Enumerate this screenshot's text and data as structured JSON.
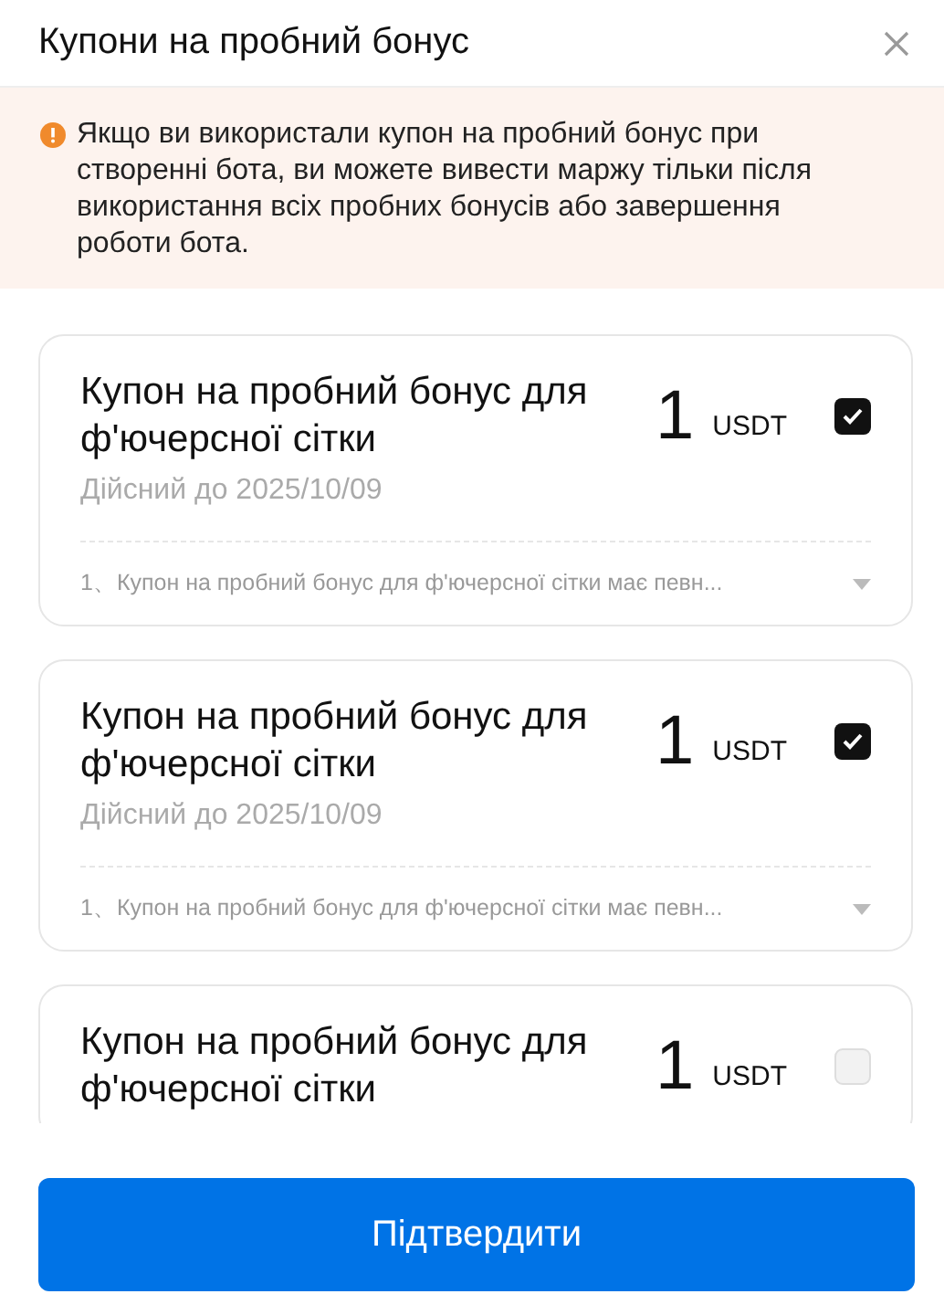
{
  "header": {
    "title": "Купони на пробний бонус"
  },
  "notice": {
    "text": "Якщо ви використали купон на пробний бонус при створенні бота, ви можете вивести маржу тільки після використання всіх пробних бонусів або завершення роботи бота."
  },
  "coupons": [
    {
      "title": "Купон на пробний бонус для ф'ючерсної сітки",
      "amount": "1",
      "currency": "USDT",
      "checked": true,
      "validity": "Дійсний до 2025/10/09",
      "description": "1、Купон на пробний бонус для ф'ючерсної сітки має певн..."
    },
    {
      "title": "Купон на пробний бонус для ф'ючерсної сітки",
      "amount": "1",
      "currency": "USDT",
      "checked": true,
      "validity": "Дійсний до 2025/10/09",
      "description": "1、Купон на пробний бонус для ф'ючерсної сітки має певн..."
    },
    {
      "title": "Купон на пробний бонус для ф'ючерсної сітки",
      "amount": "1",
      "currency": "USDT",
      "checked": false
    }
  ],
  "confirm_button": {
    "label": "Підтвердити"
  }
}
